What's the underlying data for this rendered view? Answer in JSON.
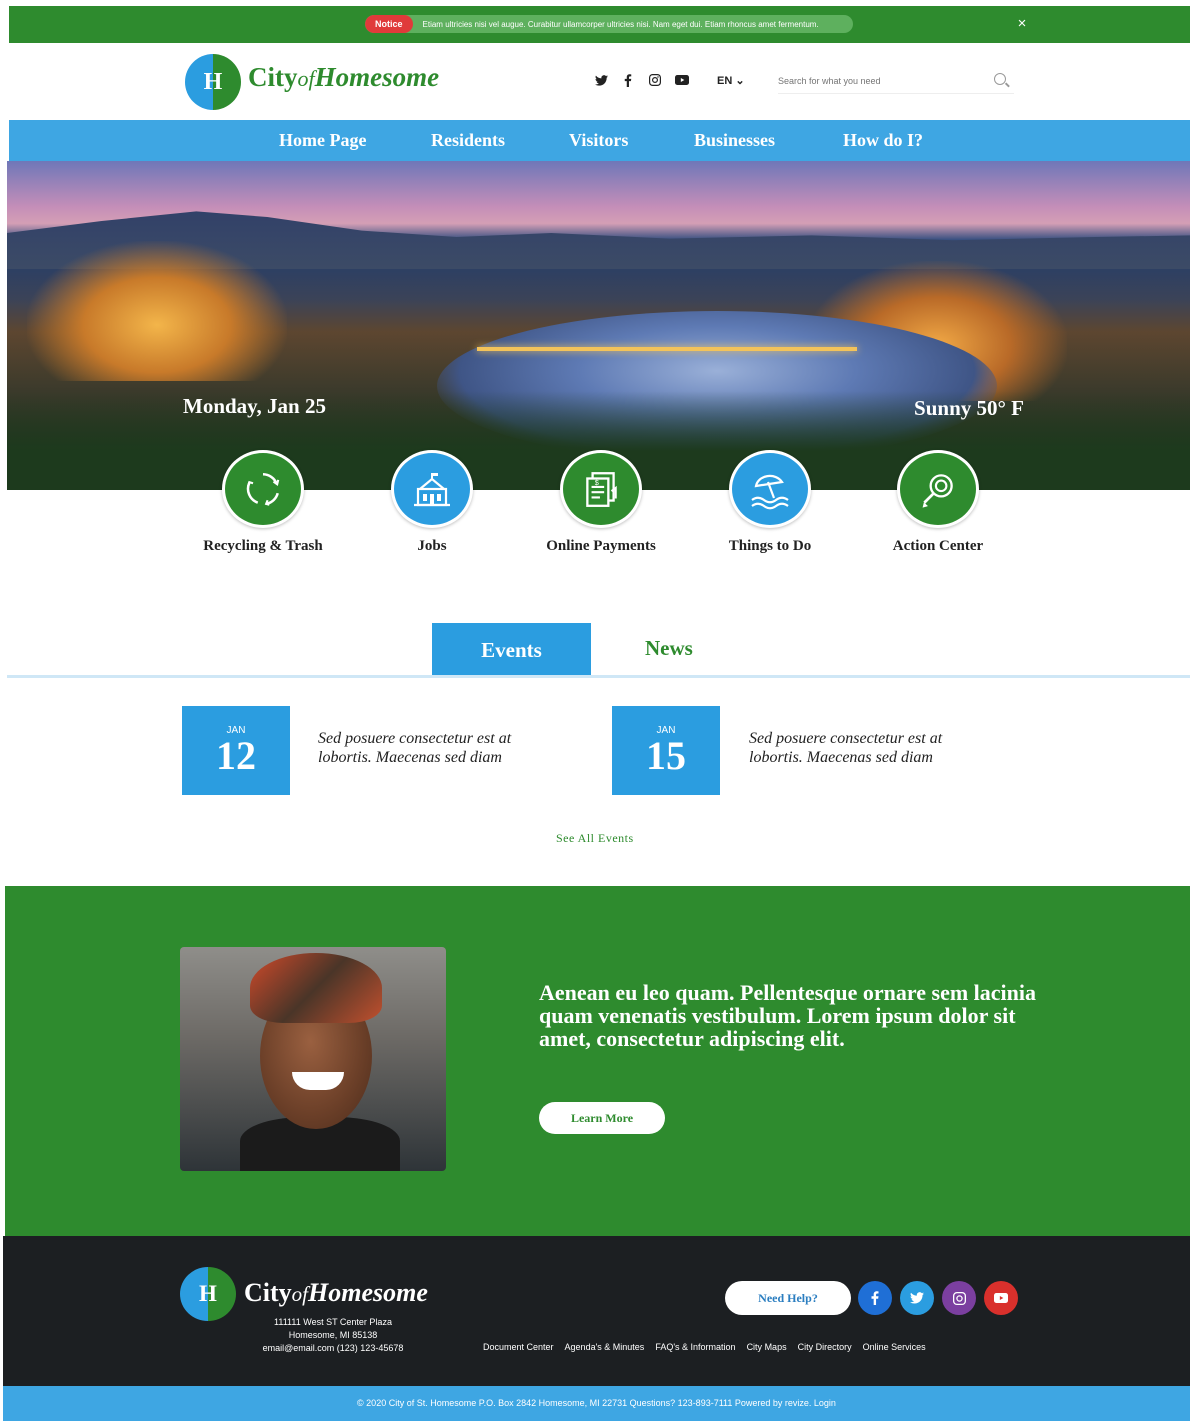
{
  "notice": {
    "label": "Notice",
    "text": "Etiam ultricies nisi vel augue. Curabitur ullamcorper ultricies nisi. Nam eget dui. Etiam rhoncus amet fermentum.",
    "close": "×"
  },
  "header": {
    "logo_letter": "H",
    "logo_part1": "City",
    "logo_part2": "of",
    "logo_part3": "Homesome",
    "social_icons": [
      "twitter-icon",
      "facebook-icon",
      "instagram-icon",
      "youtube-icon"
    ],
    "language": "EN ⌄",
    "search_placeholder": "Search for what you need"
  },
  "nav": {
    "items": [
      "Home Page",
      "Residents",
      "Visitors",
      "Businesses",
      "How do I?"
    ]
  },
  "hero": {
    "date": "Monday, Jan 25",
    "weather": "Sunny 50° F"
  },
  "quick_links": [
    {
      "label": "Recycling & Trash",
      "icon": "recycle-icon",
      "color": "#2e8b2e"
    },
    {
      "label": "Jobs",
      "icon": "building-icon",
      "color": "#2b9de0"
    },
    {
      "label": "Online Payments",
      "icon": "payment-document-icon",
      "color": "#2e8b2e"
    },
    {
      "label": "Things to Do",
      "icon": "beach-umbrella-icon",
      "color": "#2b9de0"
    },
    {
      "label": "Action Center",
      "icon": "action-center-icon",
      "color": "#2e8b2e"
    }
  ],
  "tabs": {
    "events": "Events",
    "news": "News"
  },
  "events": [
    {
      "month": "JAN",
      "day": "12",
      "text": "Sed posuere consectetur est at lobortis. Maecenas sed diam"
    },
    {
      "month": "JAN",
      "day": "15",
      "text": "Sed posuere consectetur est at lobortis. Maecenas sed diam"
    }
  ],
  "see_all": "See All Events",
  "feature": {
    "text": "Aenean eu leo quam. Pellentesque ornare sem lacinia quam venenatis vestibulum. Lorem ipsum dolor sit amet, consectetur adipiscing elit.",
    "button": "Learn More"
  },
  "footer": {
    "logo_letter": "H",
    "logo_part1": "City",
    "logo_part2": "of",
    "logo_part3": "Homesome",
    "address_line1": "111111 West ST Center Plaza",
    "address_line2": "Homesome, MI 85138",
    "address_line3": "email@email.com (123) 123-45678",
    "need_help": "Need Help?",
    "social_icons": [
      "facebook-icon",
      "twitter-icon",
      "instagram-icon",
      "youtube-icon"
    ],
    "social_colors": [
      "#1f6fd6",
      "#2b9de0",
      "#7b3fa0",
      "#d9302c"
    ],
    "links": [
      "Document Center",
      "Agenda's & Minutes",
      "FAQ's & Information",
      "City Maps",
      "City Directory",
      "Online Services"
    ]
  },
  "bottom_bar": "© 2020   City of St. Homesome P.O. Box 2842 Homesome, MI 22731   Questions? 123-893-7111   Powered by revize. Login",
  "colors": {
    "green": "#2e8b2e",
    "blue": "#2b9de0",
    "nav_blue": "#3ea6e3",
    "footer_dark": "#1c1f22"
  }
}
